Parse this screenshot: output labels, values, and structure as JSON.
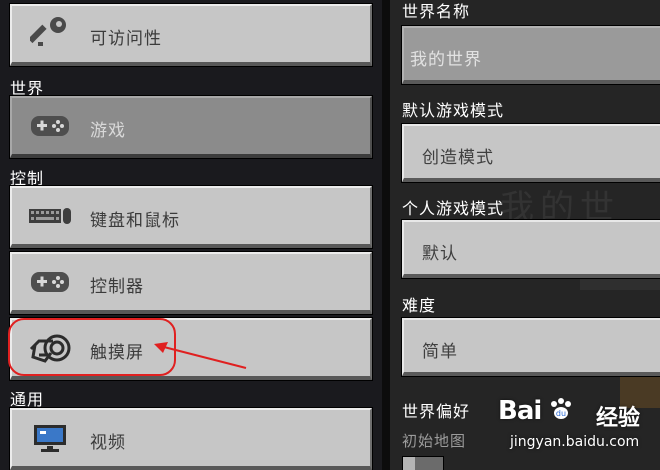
{
  "left_panel": {
    "accessibility_label": "可访问性",
    "sections": {
      "world": "世界",
      "controls": "控制",
      "general": "通用"
    },
    "items": {
      "game": "游戏",
      "keyboard_mouse": "键盘和鼠标",
      "controller": "控制器",
      "touchscreen": "触摸屏",
      "video": "视频"
    },
    "selected_item": "游戏"
  },
  "right_panel": {
    "world_name": {
      "label": "世界名称",
      "value": "我的世界"
    },
    "default_game_mode": {
      "label": "默认游戏模式",
      "value": "创造模式"
    },
    "personal_game_mode": {
      "label": "个人游戏模式",
      "value": "默认"
    },
    "difficulty": {
      "label": "难度",
      "value": "简单"
    },
    "world_preferences": {
      "label": "世界偏好"
    },
    "starting_map": {
      "label": "初始地图"
    },
    "background_text": "我的世"
  },
  "watermark": {
    "logo_left": "Bai",
    "logo_right": "经验",
    "url": "jingyan.baidu.com"
  },
  "colors": {
    "button_face": "#c6c6c6",
    "button_selected": "#8b8b8b",
    "annotation": "#e02020"
  }
}
